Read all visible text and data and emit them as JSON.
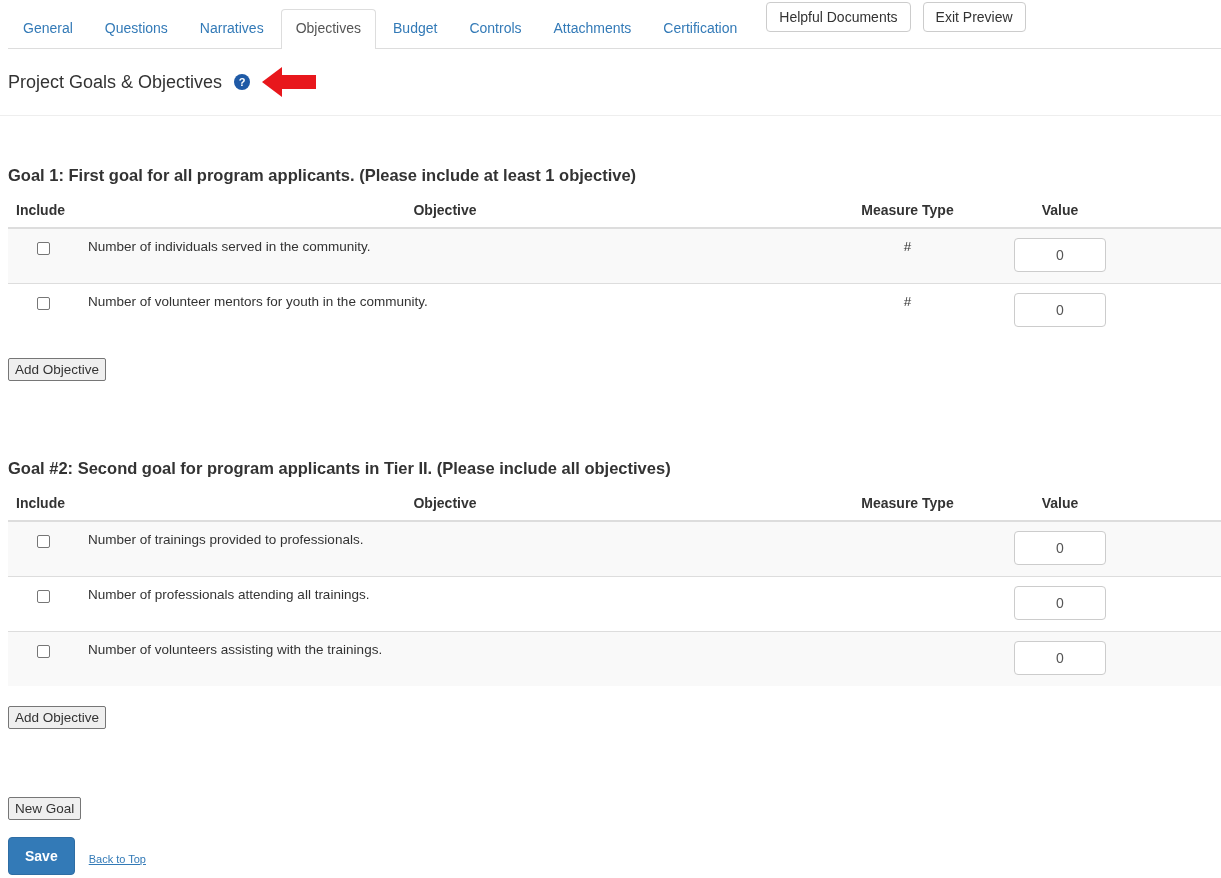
{
  "tabs": [
    {
      "label": "General",
      "selected": false
    },
    {
      "label": "Questions",
      "selected": false
    },
    {
      "label": "Narratives",
      "selected": false
    },
    {
      "label": "Objectives",
      "selected": true
    },
    {
      "label": "Budget",
      "selected": false
    },
    {
      "label": "Controls",
      "selected": false
    },
    {
      "label": "Attachments",
      "selected": false
    },
    {
      "label": "Certification",
      "selected": false
    }
  ],
  "tab_buttons": [
    "Helpful Documents",
    "Exit Preview"
  ],
  "page_title": "Project Goals & Objectives",
  "help_icon": "?",
  "goals": [
    {
      "heading": "Goal 1: First goal for all program applicants. (Please include at least 1 objective)",
      "columns": [
        "Include",
        "Objective",
        "Measure Type",
        "Value"
      ],
      "rows": [
        {
          "checked": false,
          "objective": "Number of individuals served in the community.",
          "measure_type": "#",
          "value": "0"
        },
        {
          "checked": false,
          "objective": "Number of volunteer mentors for youth in the community.",
          "measure_type": "#",
          "value": "0"
        }
      ],
      "add_button": "Add Objective"
    },
    {
      "heading": "Goal #2: Second goal for program applicants in Tier II. (Please include all objectives)",
      "columns": [
        "Include",
        "Objective",
        "Measure Type",
        "Value"
      ],
      "rows": [
        {
          "checked": false,
          "objective": "Number of trainings provided to professionals.",
          "value": "0"
        },
        {
          "checked": false,
          "objective": "Number of professionals attending all trainings.",
          "value": "0"
        },
        {
          "checked": false,
          "objective": "Number of volunteers assisting with the trainings.",
          "value": "0"
        }
      ],
      "add_button": "Add Objective"
    }
  ],
  "new_goal_button": "New Goal",
  "save_button": "Save",
  "back_link": "Back to Top"
}
